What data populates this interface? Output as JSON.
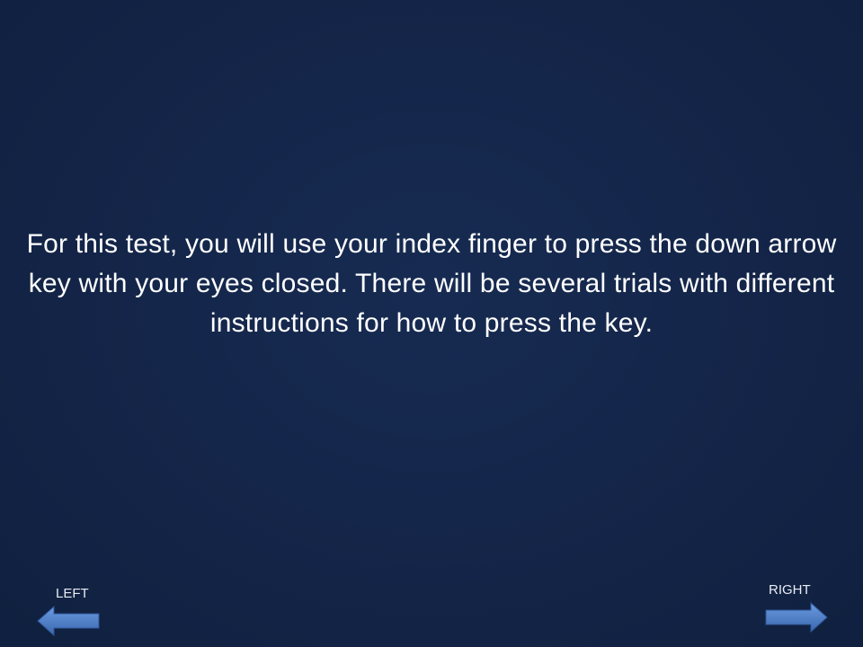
{
  "slide": {
    "instruction": "For this test, you will use your index finger to press the down arrow key with your eyes closed.  There will be several trials with different instructions for how to press the key."
  },
  "navigation": {
    "left_label": "LEFT",
    "right_label": "RIGHT",
    "left_icon": "left-arrow-icon",
    "right_icon": "right-arrow-icon",
    "arrow_color": "#4a7bc4",
    "background_color": "#14254a"
  }
}
